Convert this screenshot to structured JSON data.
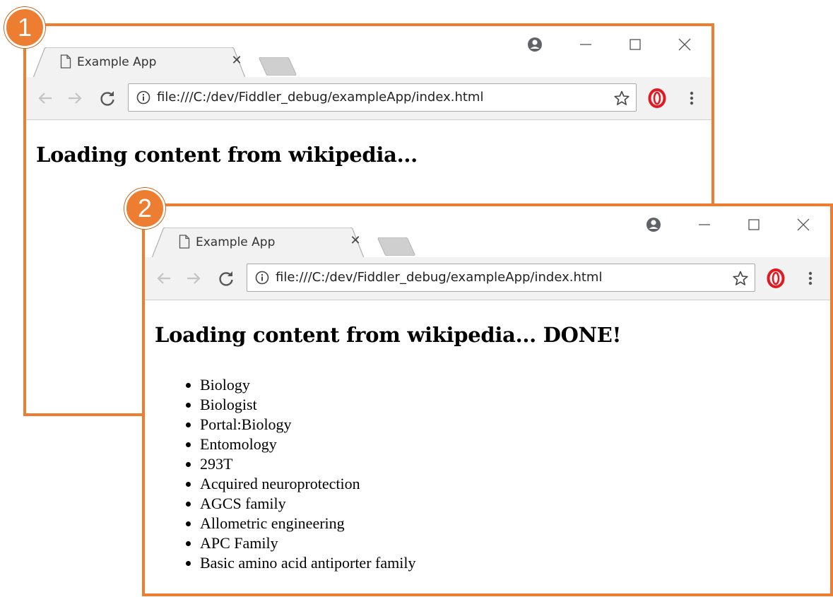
{
  "colors": {
    "accent": "#ed7d31",
    "badge_text": "#ffffff"
  },
  "badges": {
    "first": "1",
    "second": "2"
  },
  "windows": [
    {
      "tab_title": "Example App",
      "url": "file:///C:/dev/Fiddler_debug/exampleApp/index.html",
      "heading": "Loading content from wikipedia...",
      "items": []
    },
    {
      "tab_title": "Example App",
      "url": "file:///C:/dev/Fiddler_debug/exampleApp/index.html",
      "heading": "Loading content from wikipedia... DONE!",
      "items": [
        "Biology",
        "Biologist",
        "Portal:Biology",
        "Entomology",
        "293T",
        "Acquired neuroprotection",
        "AGCS family",
        "Allometric engineering",
        "APC Family",
        "Basic amino acid antiporter family"
      ]
    }
  ],
  "icons": {
    "tab": "document-icon",
    "close_tab": "close-icon",
    "profile": "profile-icon",
    "minimize": "minimize-icon",
    "maximize": "maximize-icon",
    "close_window": "close-icon",
    "back": "back-arrow-icon",
    "forward": "forward-arrow-icon",
    "reload": "reload-icon",
    "info": "info-icon",
    "bookmark": "star-icon",
    "opera": "opera-icon",
    "menu": "kebab-menu-icon"
  }
}
